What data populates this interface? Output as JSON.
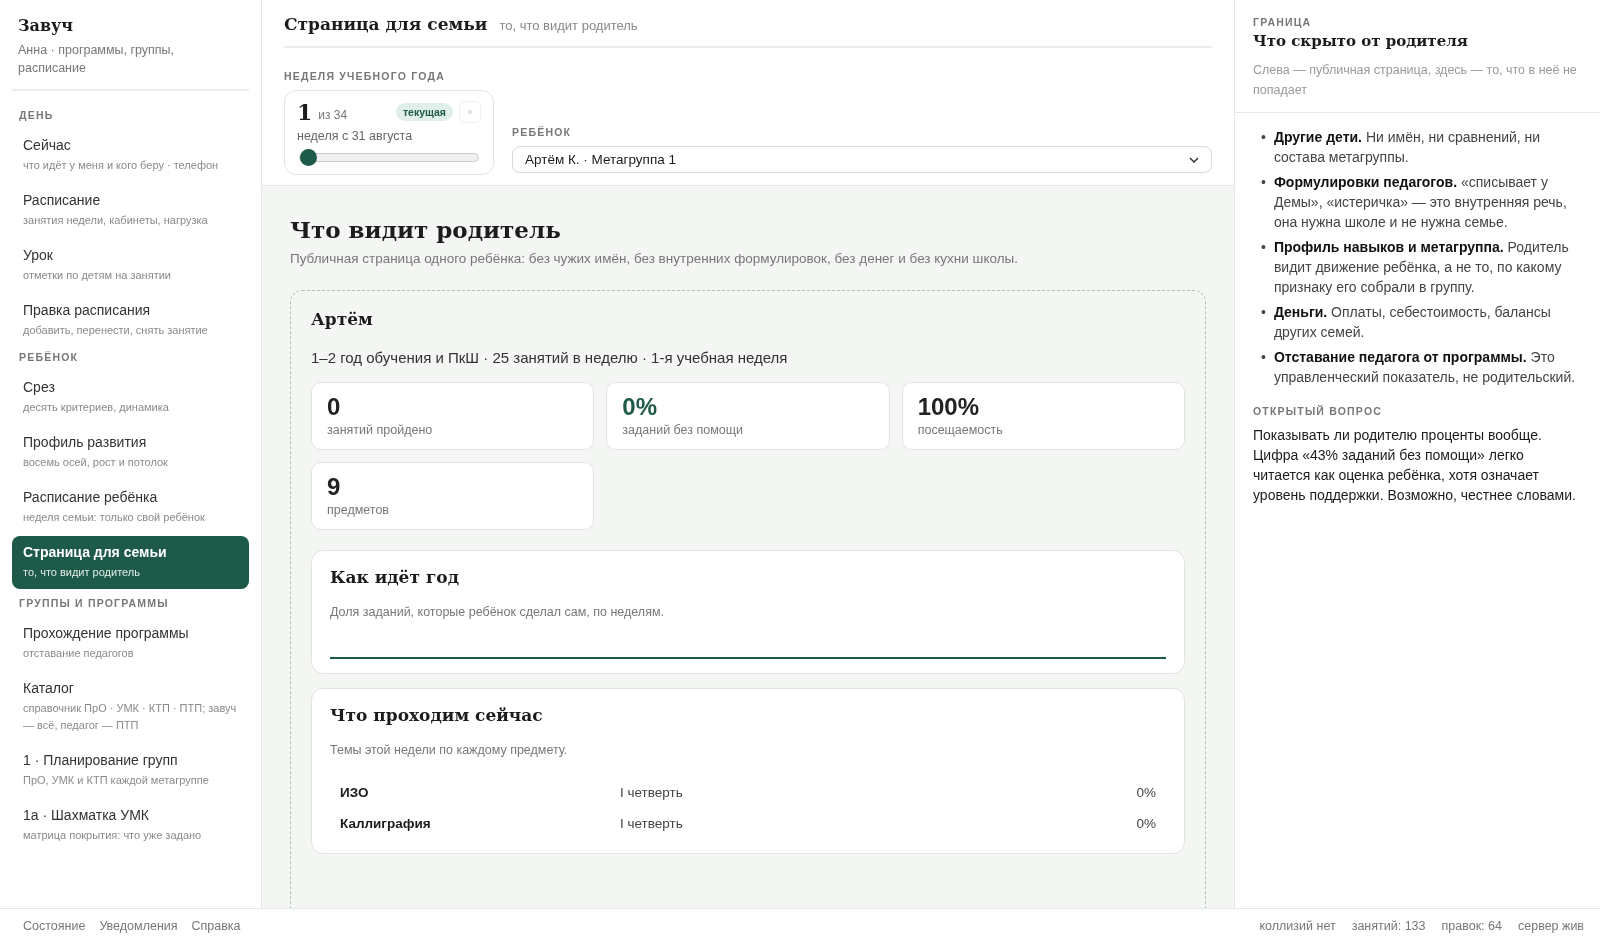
{
  "sidebar": {
    "title": "Завуч",
    "subtitle": "Анна · программы, группы, расписание",
    "sections": [
      {
        "heading": "ДЕНЬ",
        "items": [
          {
            "label": "Сейчас",
            "hint": "что идёт у меня и кого беру · телефон",
            "selected": false
          },
          {
            "label": "Расписание",
            "hint": "занятия недели, кабинеты, нагрузка",
            "selected": false
          },
          {
            "label": "Урок",
            "hint": "отметки по детям на занятии",
            "selected": false
          },
          {
            "label": "Правка расписания",
            "hint": "добавить, перенести, снять занятие",
            "selected": false
          }
        ]
      },
      {
        "heading": "РЕБЁНОК",
        "items": [
          {
            "label": "Срез",
            "hint": "десять критериев, динамика",
            "selected": false
          },
          {
            "label": "Профиль развития",
            "hint": "восемь осей, рост и потолок",
            "selected": false
          },
          {
            "label": "Расписание ребёнка",
            "hint": "неделя семьи: только свой ребёнок",
            "selected": false
          },
          {
            "label": "Страница для семьи",
            "hint": "то, что видит родитель",
            "selected": true
          }
        ]
      },
      {
        "heading": "ГРУППЫ И ПРОГРАММЫ",
        "items": [
          {
            "label": "Прохождение программы",
            "hint": "отставание педагогов",
            "selected": false
          },
          {
            "label": "Каталог",
            "hint": "справочник ПрО · УМК · КТП · ПТП; завуч — всё, педагог — ПТП",
            "selected": false
          },
          {
            "label": "1 · Планирование групп",
            "hint": "ПрО, УМК и КТП каждой метагруппе",
            "selected": false
          },
          {
            "label": "1а · Шахматка УМК",
            "hint": "матрица покрытия: что уже задано",
            "selected": false
          }
        ]
      }
    ]
  },
  "header": {
    "title": "Страница для семьи",
    "subtitle": "то, что видит родитель"
  },
  "week": {
    "label": "НЕДЕЛЯ УЧЕБНОГО ГОДА",
    "number": "1",
    "of": "из 34",
    "badge": "текущая",
    "date": "неделя с 31 августа",
    "level": 0
  },
  "child_select": {
    "label": "РЕБЁНОК",
    "value": "Артём К. · Метагруппа 1"
  },
  "preview": {
    "title": "Что видит родитель",
    "description": "Публичная страница одного ребёнка: без чужих имён, без внутренних формулировок, без денег и без кухни школы.",
    "name": "Артём",
    "summary": "1–2 год обучения и ПкШ · 25 занятий в неделю · 1-я учебная неделя",
    "stats": [
      {
        "value": "0",
        "label": "занятий пройдено",
        "accent": false
      },
      {
        "value": "0%",
        "label": "заданий без помощи",
        "accent": true
      },
      {
        "value": "100%",
        "label": "посещаемость",
        "accent": false
      },
      {
        "value": "9",
        "label": "предметов",
        "accent": false
      }
    ],
    "year": {
      "title": "Как идёт год",
      "description": "Доля заданий, которые ребёнок сделал сам, по неделям."
    },
    "now": {
      "title": "Что проходим сейчас",
      "description": "Темы этой недели по каждому предмету.",
      "rows": [
        {
          "subject": "ИЗО",
          "topic": "I четверть",
          "progress": "0%"
        },
        {
          "subject": "Каллиграфия",
          "topic": "I четверть",
          "progress": "0%"
        }
      ]
    }
  },
  "aside": {
    "kicker": "ГРАНИЦА",
    "title": "Что скрыто от родителя",
    "description": "Слева — публичная страница, здесь — то, что в неё не попадает",
    "bullets": [
      {
        "marker": "•",
        "text": "**Другие дети.** Ни имён, ни сравнений, ни состава метагруппы."
      },
      {
        "marker": "•",
        "text": "**Формулировки педагогов.** «списывает у Демы», «истеричка» — это внутренняя речь, она нужна школе и не нужна семье."
      },
      {
        "marker": "•",
        "text": "**Профиль навыков и метагруппа.** Родитель видит движение ребёнка, а не то, по какому признаку его собрали в группу."
      },
      {
        "marker": "•",
        "text": "**Деньги.** Оплаты, себестоимость, балансы других семей."
      },
      {
        "marker": "•",
        "text": "**Отставание педагога от программы.** Это управленческий показатель, не родительский."
      }
    ],
    "question_label": "ОТКРЫТЫЙ ВОПРОС",
    "question": "Показывать ли родителю проценты вообще. Цифра «43% заданий без помощи» легко читается как оценка ребёнка, хотя означает уровень поддержки. Возможно, честнее словами."
  },
  "status_bar": {
    "links": [
      "Состояние",
      "Уведомления",
      "Справка"
    ],
    "stats": [
      "коллизий нет",
      "занятий: 133",
      "правок: 64",
      "сервер жив"
    ]
  }
}
